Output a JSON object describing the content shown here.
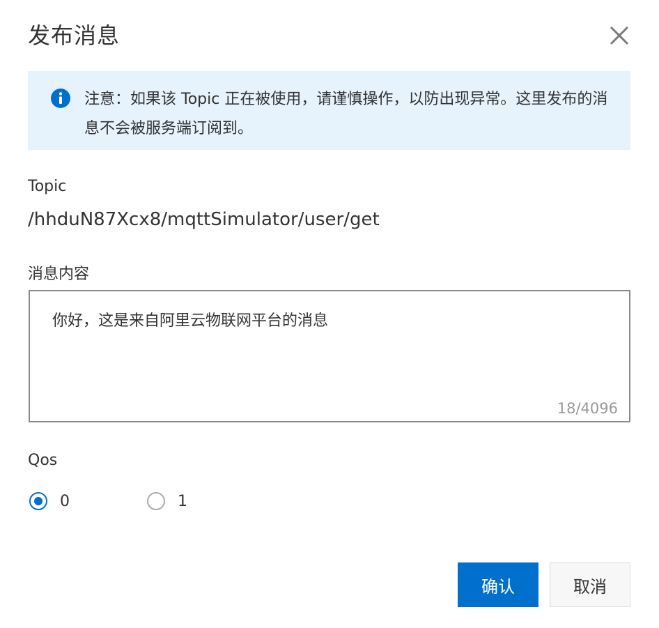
{
  "dialog": {
    "title": "发布消息"
  },
  "notice": {
    "icon": "info-icon",
    "text": "注意：如果该 Topic 正在被使用，请谨慎操作，以防出现异常。这里发布的消息不会被服务端订阅到。"
  },
  "topic": {
    "label": "Topic",
    "value": "/hhduN87Xcx8/mqttSimulator/user/get"
  },
  "message": {
    "label": "消息内容",
    "value": "你好，这是来自阿里云物联网平台的消息",
    "counter": "18/4096"
  },
  "qos": {
    "label": "Qos",
    "options": [
      {
        "label": "0",
        "checked": true
      },
      {
        "label": "1",
        "checked": false
      }
    ]
  },
  "buttons": {
    "confirm": "确认",
    "cancel": "取消"
  },
  "colors": {
    "primary": "#0070cc",
    "notice_bg": "#e6f2fc"
  }
}
